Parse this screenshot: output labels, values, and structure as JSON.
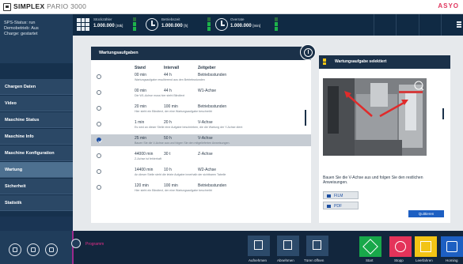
{
  "titlebar": {
    "brand": "SIMPLEX",
    "model": "PARIO 3000",
    "warning_text": "ASYO"
  },
  "counters": [
    {
      "label": "Stückzähler",
      "value": "1.000.000",
      "unit": "[Stk]"
    },
    {
      "label": "Betriebszeit",
      "value": "1.000.000",
      "unit": "[h]"
    },
    {
      "label": "Overrate",
      "value": "1.000.000",
      "unit": "[min]"
    }
  ],
  "status": {
    "lines": [
      "SPS-Status: run",
      "Demobetrieb: Aus",
      "Charge: gestartet"
    ]
  },
  "nav": {
    "items": [
      "Chargen Daten",
      "Video",
      "Maschine Status",
      "Maschine Info",
      "Maschine Konfiguration",
      "Wartung",
      "Sicherheit",
      "Statistik"
    ],
    "active_index": 5
  },
  "table": {
    "title": "Wartungsaufgaben",
    "columns": [
      "Stand",
      "Intervall",
      "Zeitgeber"
    ],
    "rows": [
      {
        "stand": "00 min",
        "interval": "44 h",
        "timer": "Betriebsstunden",
        "desc": "Wartungsaufgabe resultierend aus den Betriebsstunden",
        "selected": false
      },
      {
        "stand": "00 min",
        "interval": "44 h",
        "timer": "W1-Achse",
        "desc": "Die W1-Achse muss hier steht Blindtext",
        "selected": false
      },
      {
        "stand": "20 min",
        "interval": "100 min",
        "timer": "Betriebsstunden",
        "desc": "Hier steht ein Blindtext, der eine Wartungsaufgabe beschreibt",
        "selected": false
      },
      {
        "stand": "1 min",
        "interval": "20 h",
        "timer": "V-Achse",
        "desc": "Es wird an dieser Stelle eine Aufgabe beschrieben, die die Wartung der Y-Achse dient",
        "selected": false
      },
      {
        "stand": "25 min",
        "interval": "50 h",
        "timer": "V-Achse",
        "desc": "Bauen Sie die V-Achse aus und folgen Sie den mitgelieferten Anweisungen.",
        "selected": true
      },
      {
        "stand": "44000 min",
        "interval": "30 t",
        "timer": "Z-Achse",
        "desc": "Z-Achse ist fehlerhaft",
        "selected": false
      },
      {
        "stand": "14400 min",
        "interval": "10 h",
        "timer": "W2-Achse",
        "desc": "An dieser Stelle steht die letzte Aufgabe innerhalb der sichtbaren Tabelle",
        "selected": false
      },
      {
        "stand": "120 min",
        "interval": "100 min",
        "timer": "Betriebsstunden",
        "desc": "Hier steht ein Blindtext, der eine Wartungsaufgabe beschreibt",
        "selected": false
      }
    ]
  },
  "detail": {
    "title": "Wartungsaufgabe selektiert",
    "text": "Bauen Sie die V-Achse aus und folgen Sie den restlichen Anweisungen.",
    "film_label": "FILM",
    "pdf_label": "PDF",
    "quit_label": "Quittieren"
  },
  "bottom": {
    "program_label": "Programm",
    "actions": [
      "Aufnehmen",
      "Abnehmen",
      "Türen öffnen"
    ],
    "controls": [
      {
        "label": "Start",
        "color": "#18a84a"
      },
      {
        "label": "Stopp",
        "color": "#e4335a"
      },
      {
        "label": "Leerfahren",
        "color": "#f2c415"
      },
      {
        "label": "Homing",
        "color": "#1d5fc2"
      }
    ]
  },
  "colors": {
    "accent_blue": "#1d5fc2",
    "status_green": "#1db34b",
    "warning_pink": "#e0355d"
  }
}
